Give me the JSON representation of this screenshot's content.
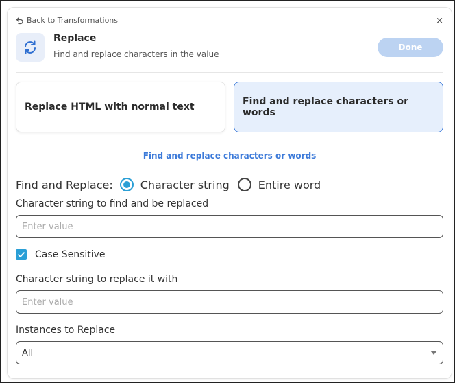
{
  "header": {
    "back_label": "Back to Transformations",
    "close_glyph": "×",
    "title": "Replace",
    "subtitle": "Find and replace characters in the value",
    "done_label": "Done",
    "title_icon": "refresh-icon"
  },
  "options": {
    "left_label": "Replace HTML with normal text",
    "right_label": "Find and replace characters or words",
    "selected": "right"
  },
  "section": {
    "label": "Find and replace characters or words"
  },
  "find_mode": {
    "label": "Find and Replace:",
    "options": [
      {
        "label": "Character string",
        "selected": true
      },
      {
        "label": "Entire word",
        "selected": false
      }
    ]
  },
  "fields": {
    "find_label": "Character string to find and be replaced",
    "find_placeholder": "Enter value",
    "find_value": "",
    "case_label": "Case Sensitive",
    "case_checked": true,
    "replace_label": "Character string to replace it with",
    "replace_placeholder": "Enter value",
    "replace_value": "",
    "instances_label": "Instances to Replace",
    "instances_value": "All"
  },
  "colors": {
    "accent": "#3c7ad9",
    "radio_accent": "#2a9fd6",
    "done_bg": "#bcd3f2",
    "selected_card_bg": "#e6effc"
  }
}
